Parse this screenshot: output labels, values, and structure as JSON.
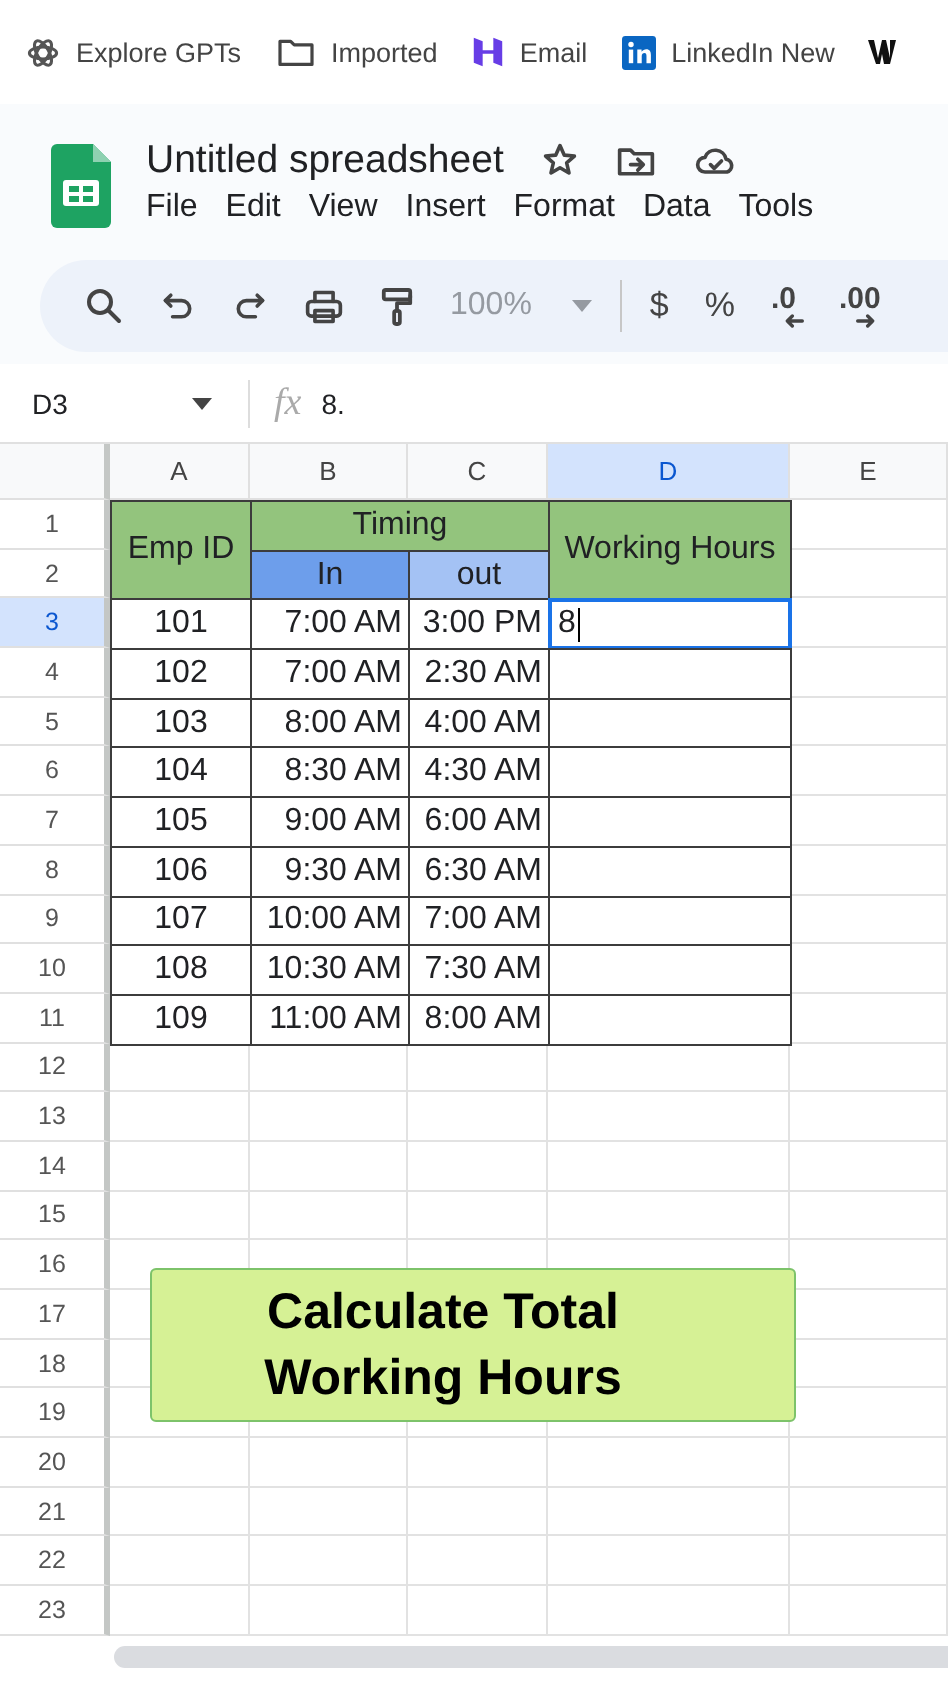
{
  "bookmarks": [
    {
      "kind": "knot",
      "label": "Explore GPTs"
    },
    {
      "kind": "folder",
      "label": "Imported"
    },
    {
      "kind": "hbrand",
      "label": "Email"
    },
    {
      "kind": "linked",
      "label": "LinkedIn New"
    },
    {
      "kind": "wlogo"
    }
  ],
  "document": {
    "title": "Untitled spreadsheet",
    "actions": [
      {
        "kind": "star"
      },
      {
        "kind": "move"
      },
      {
        "kind": "cloud"
      }
    ],
    "menus": [
      "File",
      "Edit",
      "View",
      "Insert",
      "Format",
      "Data",
      "Tools"
    ]
  },
  "toolbar": [
    {
      "kind": "search"
    },
    {
      "kind": "undo"
    },
    {
      "kind": "redo"
    },
    {
      "kind": "print"
    },
    {
      "kind": "paint"
    },
    {
      "kind": "zoom",
      "text": "100%",
      "disabled": true
    },
    {
      "kind": "divider"
    },
    {
      "kind": "text",
      "text": "$"
    },
    {
      "kind": "text",
      "text": "%"
    },
    {
      "kind": "decrease",
      "text": ".0"
    },
    {
      "kind": "increase",
      "text": ".00"
    }
  ],
  "formula_bar": {
    "name_box": "D3",
    "fx": "fx",
    "value": "8."
  },
  "sheet": {
    "columns": [
      {
        "label": "A",
        "selected": false
      },
      {
        "label": "B",
        "selected": false
      },
      {
        "label": "C",
        "selected": false
      },
      {
        "label": "D",
        "selected": true
      },
      {
        "label": "E",
        "selected": false
      }
    ],
    "rows": [
      {
        "label": "1",
        "selected": false
      },
      {
        "label": "2",
        "selected": false
      },
      {
        "label": "3",
        "selected": true
      },
      {
        "label": "4",
        "selected": false
      },
      {
        "label": "5",
        "selected": false
      },
      {
        "label": "6",
        "selected": false
      },
      {
        "label": "7",
        "selected": false
      },
      {
        "label": "8",
        "selected": false
      },
      {
        "label": "9",
        "selected": false
      },
      {
        "label": "10",
        "selected": false
      },
      {
        "label": "11",
        "selected": false
      },
      {
        "label": "12",
        "selected": false
      },
      {
        "label": "13",
        "selected": false
      },
      {
        "label": "14",
        "selected": false
      },
      {
        "label": "15",
        "selected": false
      },
      {
        "label": "16",
        "selected": false
      },
      {
        "label": "17",
        "selected": false
      },
      {
        "label": "18",
        "selected": false
      },
      {
        "label": "19",
        "selected": false
      },
      {
        "label": "20",
        "selected": false
      },
      {
        "label": "21",
        "selected": false
      },
      {
        "label": "22",
        "selected": false
      },
      {
        "label": "23",
        "selected": false
      }
    ],
    "table": {
      "header": {
        "emp_id": "Emp ID",
        "timing": "Timing",
        "in": "In",
        "out": "out",
        "hours": "Working Hours"
      },
      "records": [
        {
          "emp_id": "101",
          "in": "7:00 AM",
          "out": "3:00 PM",
          "hours": "8"
        },
        {
          "emp_id": "102",
          "in": "7:00 AM",
          "out": "2:30 AM"
        },
        {
          "emp_id": "103",
          "in": "8:00 AM",
          "out": "4:00 AM"
        },
        {
          "emp_id": "104",
          "in": "8:30 AM",
          "out": "4:30 AM"
        },
        {
          "emp_id": "105",
          "in": "9:00 AM",
          "out": "6:00 AM"
        },
        {
          "emp_id": "106",
          "in": "9:30 AM",
          "out": "6:30 AM"
        },
        {
          "emp_id": "107",
          "in": "10:00 AM",
          "out": "7:00 AM"
        },
        {
          "emp_id": "108",
          "in": "10:30 AM",
          "out": "7:30 AM"
        },
        {
          "emp_id": "109",
          "in": "11:00 AM",
          "out": "8:00 AM"
        }
      ]
    },
    "editing": true,
    "callout": {
      "text": "Calculate Total\nWorking Hours"
    }
  }
}
